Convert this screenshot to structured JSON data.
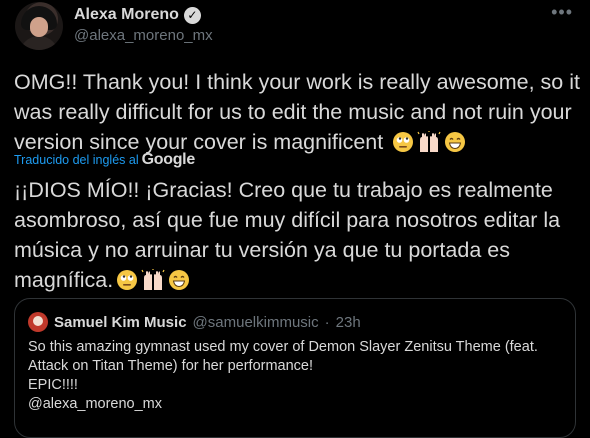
{
  "tweet": {
    "author_name": "Alexa Moreno",
    "author_handle": "@alexa_moreno_mx",
    "more_icon": "more-icon",
    "text_original": "OMG!! Thank you! I think your work is really awesome, so it was really difficult for us to edit the music and not ruin your version since your cover is magnificent",
    "translated_label": "Traducido del inglés al",
    "translator_brand": "Google",
    "text_translated": "¡¡DIOS MÍO!! ¡Gracias! Creo que tu trabajo es realmente asombroso, así que fue muy difícil para nosotros editar la música y no arruinar tu versión ya que tu portada es magnífica.",
    "emojis": [
      "face-with-rolling-eyes-emoji",
      "raising-hands-emoji",
      "grinning-face-emoji"
    ]
  },
  "quoted_tweet": {
    "author_name": "Samuel Kim Music",
    "author_handle": "@samuelkimmusic",
    "separator": "·",
    "time": "23h",
    "text": "So this amazing gymnast used my cover of Demon Slayer Zenitsu Theme (feat. Attack on Titan Theme) for her performance!\nEPIC!!!!\n@alexa_moreno_mx"
  },
  "colors": {
    "background": "#000000",
    "text": "#d9d9d9",
    "secondary_text": "#6e767d",
    "link": "#1d9bf0",
    "border": "#2f3336"
  }
}
